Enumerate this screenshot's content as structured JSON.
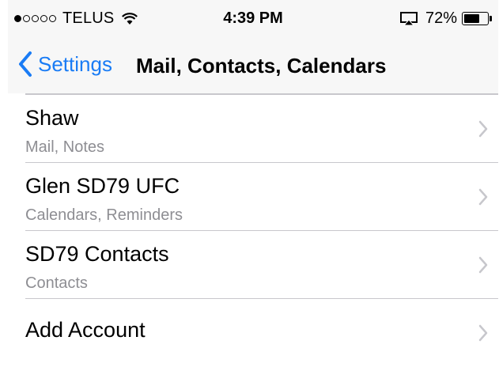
{
  "status_bar": {
    "signal_dots": [
      true,
      false,
      false,
      false,
      false
    ],
    "carrier": "TELUS",
    "time": "4:39 PM",
    "battery_percent": "72%",
    "battery_level": 0.72,
    "icons": [
      "wifi-icon",
      "airplay-icon",
      "battery-icon"
    ]
  },
  "nav_bar": {
    "back_label": "Settings",
    "title": "Mail, Contacts, Calendars",
    "accent_color": "#1a7cf5"
  },
  "accounts": [
    {
      "name": "Shaw",
      "detail": "Mail, Notes"
    },
    {
      "name": "Glen SD79 UFC",
      "detail": "Calendars, Reminders"
    },
    {
      "name": "SD79 Contacts",
      "detail": "Contacts"
    }
  ],
  "add_account": {
    "label": "Add Account"
  }
}
